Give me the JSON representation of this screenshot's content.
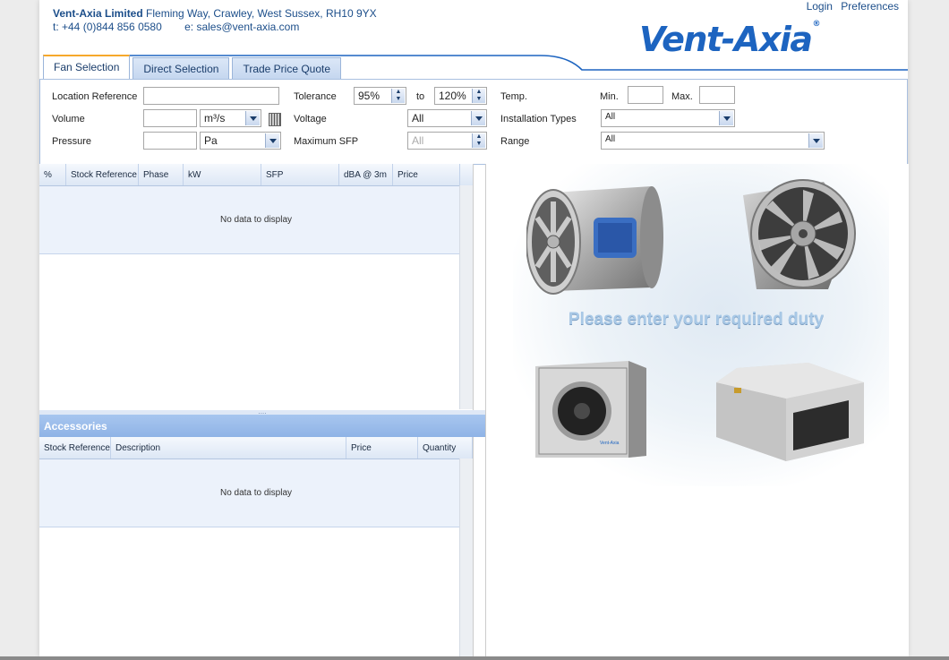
{
  "header": {
    "company_name": "Vent-Axia Limited",
    "company_address": "Fleming Way, Crawley, West Sussex, RH10 9YX",
    "phone": "t: +44 (0)844 856 0580",
    "email": "e: sales@vent-axia.com",
    "login_label": "Login",
    "preferences_label": "Preferences",
    "logo_text": "Vent-Axia",
    "logo_reg": "®"
  },
  "tabs": [
    {
      "label": "Fan Selection",
      "active": true
    },
    {
      "label": "Direct Selection",
      "active": false
    },
    {
      "label": "Trade Price Quote",
      "active": false
    }
  ],
  "form": {
    "location_reference_label": "Location Reference",
    "location_reference_value": "",
    "volume_label": "Volume",
    "volume_value": "",
    "volume_unit": "m³/s",
    "pressure_label": "Pressure",
    "pressure_value": "",
    "pressure_unit": "Pa",
    "tolerance_label": "Tolerance",
    "tolerance_from": "95%",
    "tolerance_to_label": "to",
    "tolerance_to": "120%",
    "voltage_label": "Voltage",
    "voltage_value": "All",
    "max_sfp_label": "Maximum SFP",
    "max_sfp_value": "All",
    "temp_label": "Temp.",
    "min_label": "Min.",
    "max_label": "Max.",
    "temp_min_value": "",
    "temp_max_value": "",
    "installation_types_label": "Installation Types",
    "installation_types_value": "All",
    "range_label": "Range",
    "range_value": "All"
  },
  "results_grid": {
    "columns": [
      "%",
      "Stock Reference",
      "Phase",
      "kW",
      "SFP",
      "dBA @ 3m",
      "Price"
    ],
    "empty_text": "No data to display"
  },
  "splitter_text": "....",
  "accessories": {
    "title": "Accessories",
    "columns": [
      "Stock Reference",
      "Description",
      "Price",
      "Quantity"
    ],
    "empty_text": "No data to display"
  },
  "right_panel": {
    "prompt": "Please enter your required duty",
    "box_fan_brand": "Vent-Axia"
  },
  "colors": {
    "brand_blue": "#1d64c0",
    "header_text": "#1c4e8a",
    "tab_highlight": "#f6a82b",
    "accessories_header": "#98b9ea"
  }
}
